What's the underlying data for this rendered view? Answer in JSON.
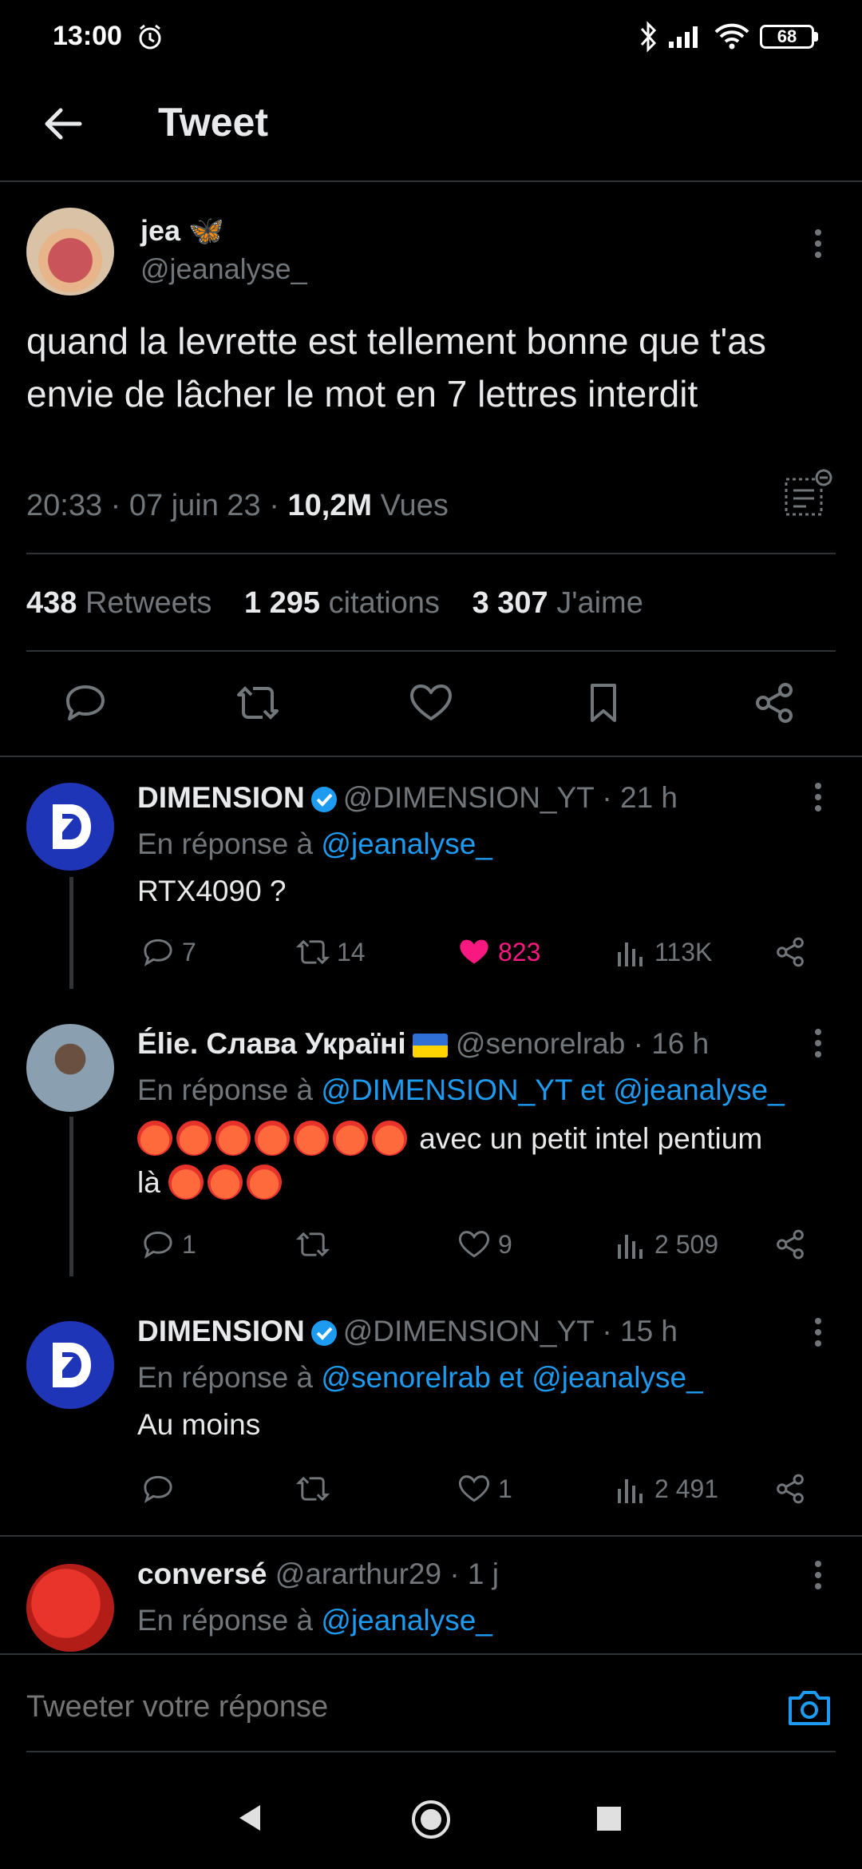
{
  "status_bar": {
    "time": "13:00",
    "battery": "68"
  },
  "header": {
    "title": "Tweet"
  },
  "main_tweet": {
    "name": "jea 🦋",
    "handle": "@jeanalyse_",
    "text": "quand la levrette est tellement bonne que t'as envie de lâcher le mot en 7 lettres interdit",
    "time_date": "20:33 · 07 juin 23 · ",
    "views_count": "10,2M",
    "views_label": " Vues",
    "retweets_count": "438",
    "retweets_label": "Retweets",
    "quotes_count": "1 295",
    "quotes_label": "citations",
    "likes_count": "3 307",
    "likes_label": "J'aime"
  },
  "replies": [
    {
      "name": "DIMENSION",
      "handle": "@DIMENSION_YT · 21 h",
      "reply_prefix": "En réponse à ",
      "reply_to": "@jeanalyse_",
      "text": "RTX4090 ?",
      "comments": "7",
      "retweets": "14",
      "likes": "823",
      "views": "113K"
    },
    {
      "name": "Élie. Слава Україні",
      "handle": "@senorelrab · 16 h",
      "reply_prefix": "En réponse à ",
      "reply_to": "@DIMENSION_YT et @jeanalyse_",
      "text_line1": "avec un petit intel pentium",
      "text_line2": "là",
      "comments": "1",
      "retweets": "",
      "likes": "9",
      "views": "2 509"
    },
    {
      "name": "DIMENSION",
      "handle": "@DIMENSION_YT · 15 h",
      "reply_prefix": "En réponse à ",
      "reply_to": "@senorelrab et @jeanalyse_",
      "text": "Au moins",
      "comments": "",
      "retweets": "",
      "likes": "1",
      "views": "2 491"
    },
    {
      "name": "conversé",
      "handle": "@ararthur29 · 1 j",
      "reply_prefix": "En réponse à ",
      "reply_to": "@jeanalyse_"
    }
  ],
  "reply_box": {
    "placeholder": "Tweeter votre réponse"
  },
  "colors": {
    "accent": "#1d9bf0",
    "like": "#f91880",
    "muted": "#71767b",
    "text": "#e7e9ea",
    "divider": "#2f3336"
  }
}
